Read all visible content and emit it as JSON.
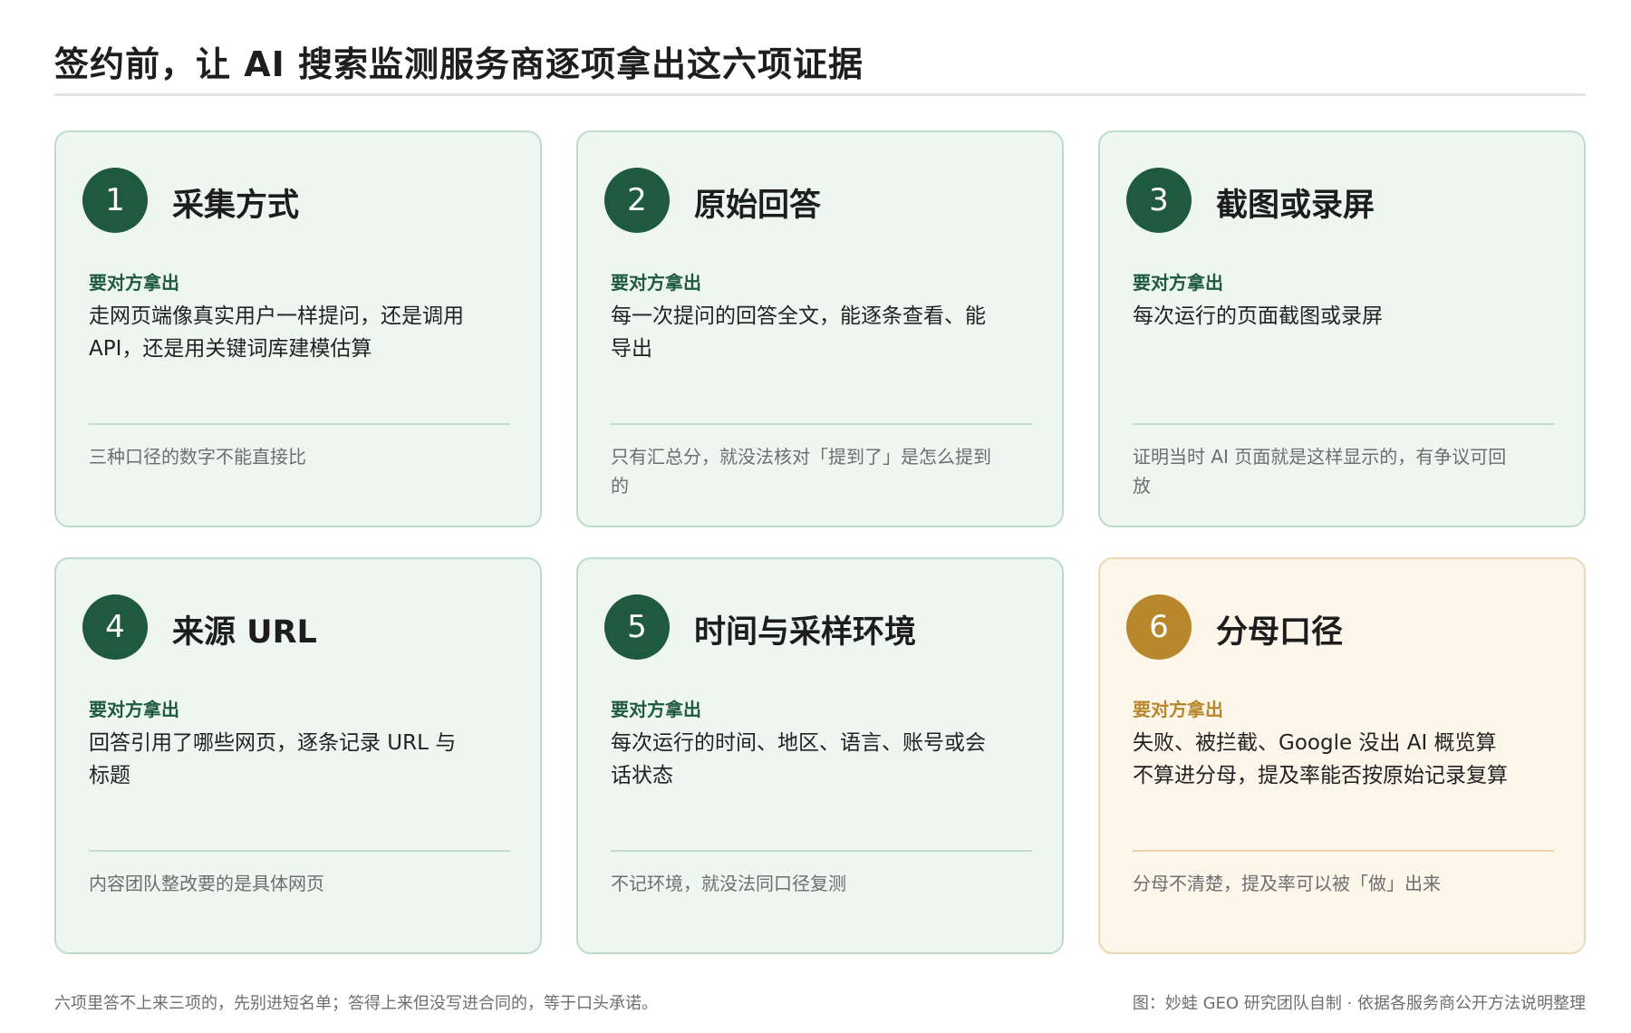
{
  "title": "签约前，让 AI 搜索监测服务商逐项拿出这六项证据",
  "cards": [
    {
      "num": "1",
      "title": "采集方式",
      "ask_label": "要对方拿出",
      "ask": "走网页端像真实用户一样提问，还是调用 API，还是用关键词库建模估算",
      "note": "三种口径的数字不能直接比"
    },
    {
      "num": "2",
      "title": "原始回答",
      "ask_label": "要对方拿出",
      "ask": "每一次提问的回答全文，能逐条查看、能导出",
      "note": "只有汇总分，就没法核对「提到了」是怎么提到的"
    },
    {
      "num": "3",
      "title": "截图或录屏",
      "ask_label": "要对方拿出",
      "ask": "每次运行的页面截图或录屏",
      "note": "证明当时 AI 页面就是这样显示的，有争议可回放"
    },
    {
      "num": "4",
      "title": "来源 URL",
      "ask_label": "要对方拿出",
      "ask": "回答引用了哪些网页，逐条记录 URL 与标题",
      "note": "内容团队整改要的是具体网页"
    },
    {
      "num": "5",
      "title": "时间与采样环境",
      "ask_label": "要对方拿出",
      "ask": "每次运行的时间、地区、语言、账号或会话状态",
      "note": "不记环境，就没法同口径复测"
    },
    {
      "num": "6",
      "title": "分母口径",
      "ask_label": "要对方拿出",
      "ask": "失败、被拦截、Google 没出 AI 概览算不算进分母，提及率能否按原始记录复算",
      "note": "分母不清楚，提及率可以被「做」出来"
    }
  ],
  "footer": {
    "left": "六项里答不上来三项的，先别进短名单；答得上来但没写进合同的，等于口头承诺。",
    "right": "图：妙蛙 GEO 研究团队自制 · 依据各服务商公开方法说明整理"
  },
  "colors": {
    "green": "#1f5a3f",
    "gold": "#b8872b",
    "card_bg": "#eef6f1",
    "warm_bg": "#fbf5ea"
  }
}
